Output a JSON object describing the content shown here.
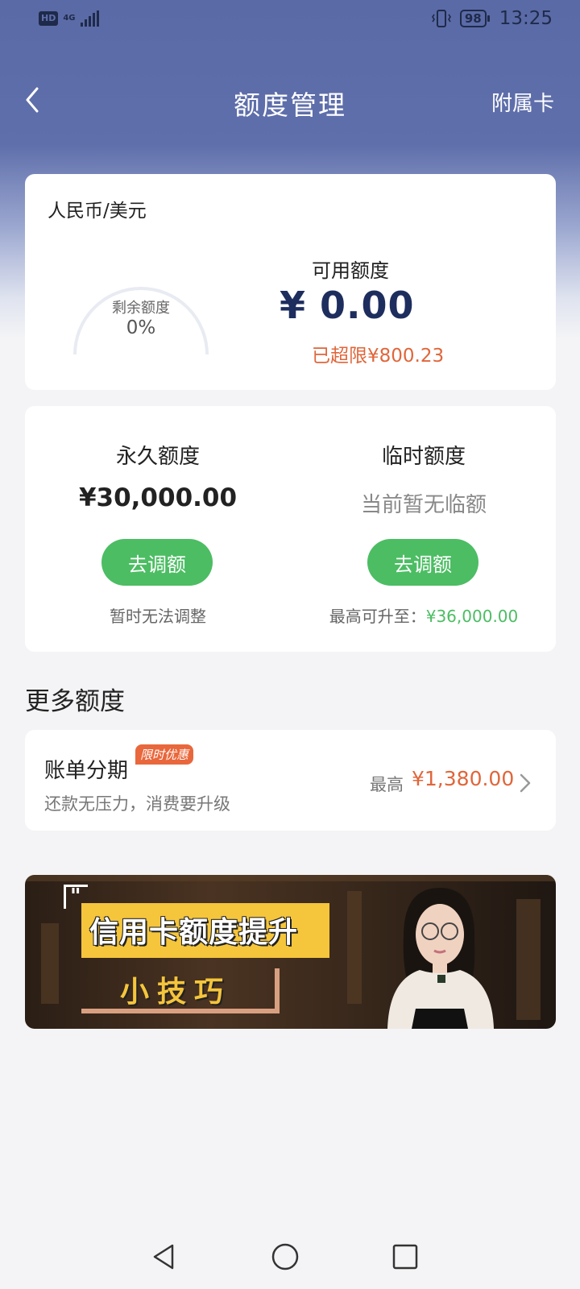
{
  "status_bar": {
    "hd": "HD",
    "network": "4G",
    "battery": "98",
    "time": "13:25"
  },
  "header": {
    "title": "额度管理",
    "right_link": "附属卡"
  },
  "summary": {
    "currency": "人民币/美元",
    "gauge_label": "剩余额度",
    "gauge_percent": "0%",
    "available_label": "可用额度",
    "available_amount": "¥ 0.00",
    "overlimit": "已超限¥800.23"
  },
  "limits": {
    "permanent": {
      "title": "永久额度",
      "amount": "¥30,000.00",
      "button": "去调额",
      "note": "暂时无法调整"
    },
    "temporary": {
      "title": "临时额度",
      "status": "当前暂无临额",
      "button": "去调额",
      "note_prefix": "最高可升至：",
      "note_amount": "¥36,000.00"
    }
  },
  "more": {
    "section_title": "更多额度",
    "installment": {
      "title": "账单分期",
      "badge": "限时优惠",
      "desc": "还款无压力，消费要升级",
      "max_label": "最高",
      "max_amount": "¥1,380.00"
    }
  },
  "banner": {
    "title": "信用卡额度提升",
    "subtitle": "小技巧"
  },
  "colors": {
    "header": "#5f6fab",
    "accent_green": "#4cbd63",
    "accent_orange": "#e0663a",
    "amount_navy": "#1d2d5e"
  }
}
